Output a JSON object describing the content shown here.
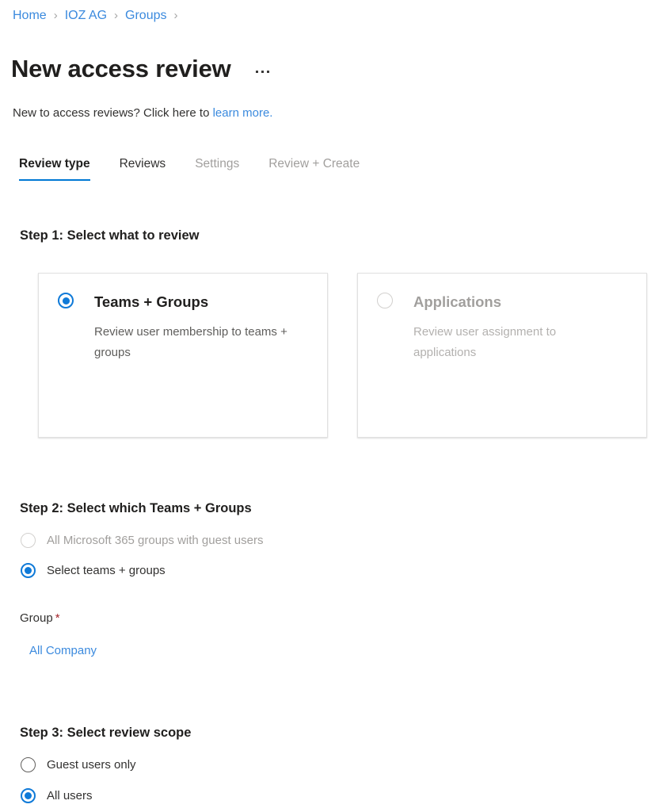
{
  "breadcrumb": {
    "separator": "›",
    "items": [
      {
        "label": "Home"
      },
      {
        "label": "IOZ AG"
      },
      {
        "label": "Groups"
      }
    ]
  },
  "header": {
    "title": "New access review",
    "more_label": "More options"
  },
  "subtitle": {
    "text": "New to access reviews? Click here to ",
    "link": "learn more."
  },
  "tabs": [
    {
      "label": "Review type",
      "state": "active"
    },
    {
      "label": "Reviews",
      "state": "enabled"
    },
    {
      "label": "Settings",
      "state": "disabled"
    },
    {
      "label": "Review + Create",
      "state": "disabled"
    }
  ],
  "step1": {
    "heading": "Step 1: Select what to review",
    "cards": [
      {
        "title": "Teams + Groups",
        "description": "Review user membership to teams + groups",
        "selected": true,
        "disabled": false
      },
      {
        "title": "Applications",
        "description": "Review user assignment to applications",
        "selected": false,
        "disabled": true
      }
    ]
  },
  "step2": {
    "heading": "Step 2: Select which Teams + Groups",
    "options": [
      {
        "label": "All Microsoft 365 groups with guest users",
        "selected": false,
        "disabled": true
      },
      {
        "label": "Select teams + groups",
        "selected": true,
        "disabled": false
      }
    ],
    "group_field": {
      "label": "Group",
      "required_marker": "*",
      "value": "All Company"
    }
  },
  "step3": {
    "heading": "Step 3: Select review scope",
    "options": [
      {
        "label": "Guest users only",
        "selected": false,
        "disabled": false
      },
      {
        "label": "All users",
        "selected": true,
        "disabled": false
      }
    ]
  },
  "colors": {
    "accent": "#0078d4",
    "link": "#3b8ade",
    "required": "#a4262c",
    "text": "#323130",
    "disabled_text": "#a19f9d"
  }
}
